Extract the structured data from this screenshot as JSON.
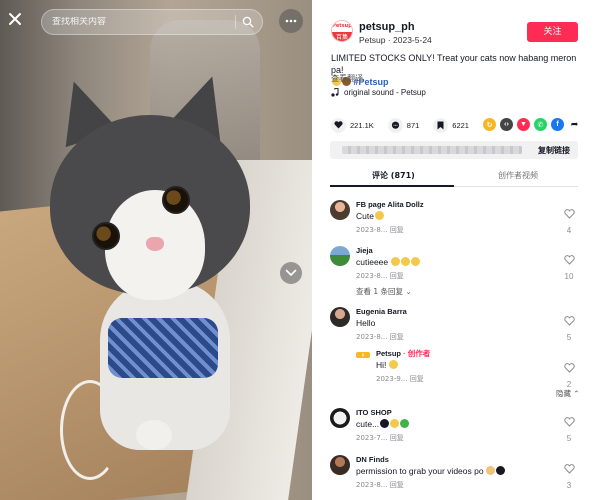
{
  "search": {
    "placeholder": "查找相关内容"
  },
  "author": {
    "name": "petsup_ph",
    "sub": "Petsup · 2023-5-24",
    "avatar_top": "Petsup",
    "avatar_bottom": "百集",
    "follow_label": "关注"
  },
  "post": {
    "description": "LIMITED STOCKS ONLY! Treat your cats now habang meron pa!",
    "hashtag": "#Petsup",
    "translate_label": "查看翻译",
    "sound": "original sound - Petsup"
  },
  "stats": {
    "likes": "221.1K",
    "comments": "871",
    "saves": "6221"
  },
  "share": {
    "copy_link": "复制链接"
  },
  "tabs": {
    "comments": "评论 (871)",
    "videos": "创作者视频"
  },
  "comments": [
    {
      "user": "FB page Alita Dollz",
      "text": "Cute",
      "meta": "2023-8...  回复",
      "likes": "4"
    },
    {
      "user": "Jieja",
      "text": "cutieeee",
      "meta": "2023-8...  回复",
      "likes": "10",
      "view_more": "查看 1 条回复 ⌄"
    },
    {
      "user": "Eugenia Barra",
      "text": "Hello",
      "meta": "2023-8...  回复",
      "likes": "5"
    },
    {
      "user": "ITO SHOP",
      "text": "cute...",
      "meta": "2023-7...  回复",
      "likes": "5"
    },
    {
      "user": "DN Finds",
      "text": "permission to grab your videos po",
      "meta": "2023-8...  回复",
      "likes": "3"
    }
  ],
  "reply": {
    "user": "Petsup",
    "author_tag": "· 创作者",
    "text": "Hi!",
    "meta": "2023-9...  回复",
    "likes": "2"
  },
  "hide_label": "隐藏 ⌃",
  "colors": {
    "accent": "#fe2c55",
    "hashtag": "#2b5db9"
  }
}
